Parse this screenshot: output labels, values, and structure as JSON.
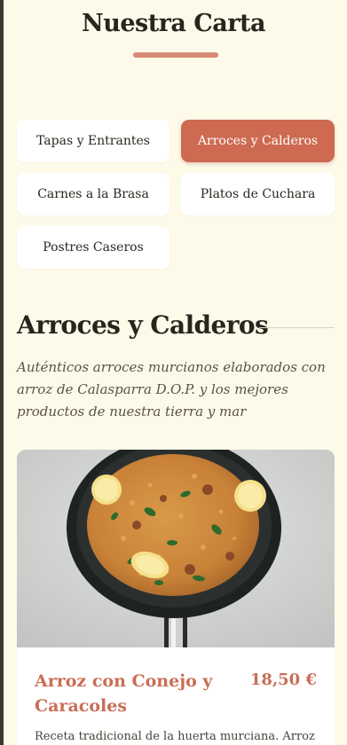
{
  "header": {
    "title": "Nuestra Carta"
  },
  "categories": [
    {
      "label": "Tapas y Entrantes",
      "active": false
    },
    {
      "label": "Arroces y Calderos",
      "active": true
    },
    {
      "label": "Carnes a la Brasa",
      "active": false
    },
    {
      "label": "Platos de Cuchara",
      "active": false
    },
    {
      "label": "Postres Caseros",
      "active": false
    }
  ],
  "section": {
    "title": "Arroces y Calderos",
    "description": "Auténticos arroces murcianos elaborados con arroz de Calasparra D.O.P. y los mejores productos de nuestra tierra y mar"
  },
  "dishes": [
    {
      "name": "Arroz con Conejo y Caracoles",
      "price": "18,50 €",
      "description": "Receta tradicional de la huerta murciana. Arroz",
      "image_icon": "paella-pan-image"
    }
  ],
  "colors": {
    "background": "#fdfae9",
    "accent": "#cd6a51",
    "dish_title": "#c96e56",
    "underline": "#d68a76"
  }
}
